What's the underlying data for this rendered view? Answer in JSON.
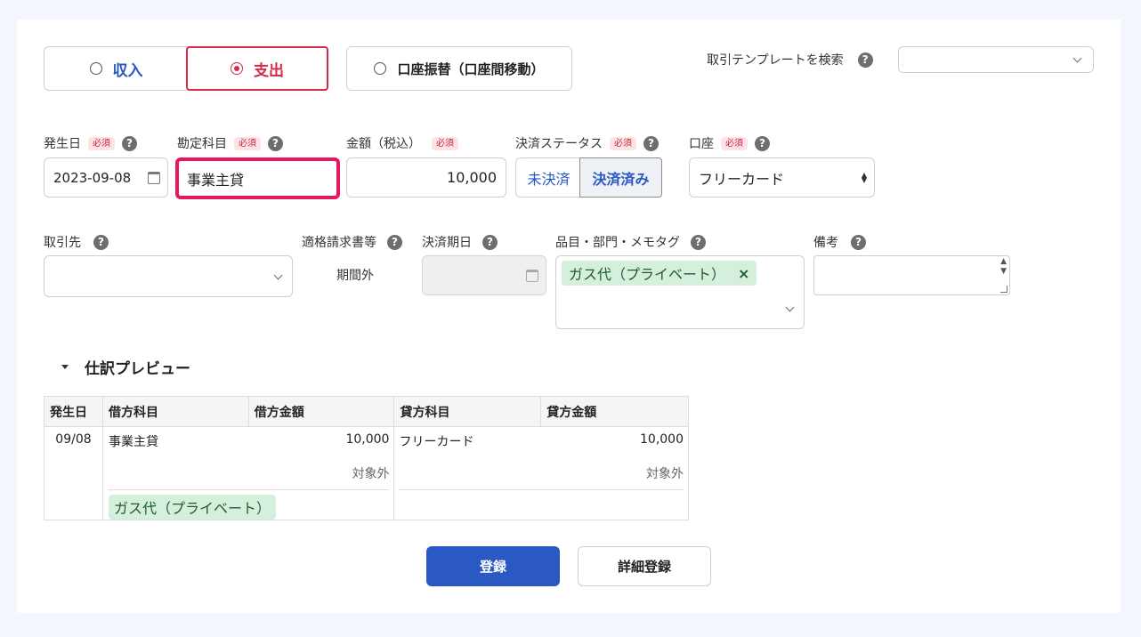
{
  "tabs": {
    "income": "収入",
    "expense": "支出",
    "transfer": "口座振替（口座間移動）"
  },
  "template": {
    "label": "取引テンプレートを検索",
    "value": ""
  },
  "help_glyph": "?",
  "required": "必須",
  "date": {
    "label": "発生日",
    "value": "2023-09-08"
  },
  "account_item": {
    "label": "勘定科目",
    "value": "事業主貸"
  },
  "amount": {
    "label": "金額（税込）",
    "value": "10,000"
  },
  "status": {
    "label": "決済ステータス",
    "unpaid": "未決済",
    "paid": "決済済み"
  },
  "wallet": {
    "label": "口座",
    "value": "フリーカード"
  },
  "partner": {
    "label": "取引先",
    "value": ""
  },
  "invoice": {
    "label": "適格請求書等",
    "value": "期間外"
  },
  "due": {
    "label": "決済期日",
    "value": ""
  },
  "tags": {
    "label": "品目・部門・メモタグ",
    "chip": "ガス代（プライベート）",
    "remove": "×"
  },
  "memo": {
    "label": "備考",
    "value": ""
  },
  "preview": {
    "title": "仕訳プレビュー",
    "headers": [
      "発生日",
      "借方科目",
      "借方金額",
      "貸方科目",
      "貸方金額"
    ],
    "row": {
      "date": "09/08",
      "debit_account": "事業主貸",
      "debit_amount": "10,000",
      "debit_tax": "対象外",
      "credit_account": "フリーカード",
      "credit_amount": "10,000",
      "credit_tax": "対象外",
      "tag": "ガス代（プライベート）"
    }
  },
  "buttons": {
    "register": "登録",
    "detail_register": "詳細登録"
  },
  "colors": {
    "accent_blue": "#2b59c3",
    "accent_red": "#d62b47",
    "highlight": "#e8175d"
  }
}
